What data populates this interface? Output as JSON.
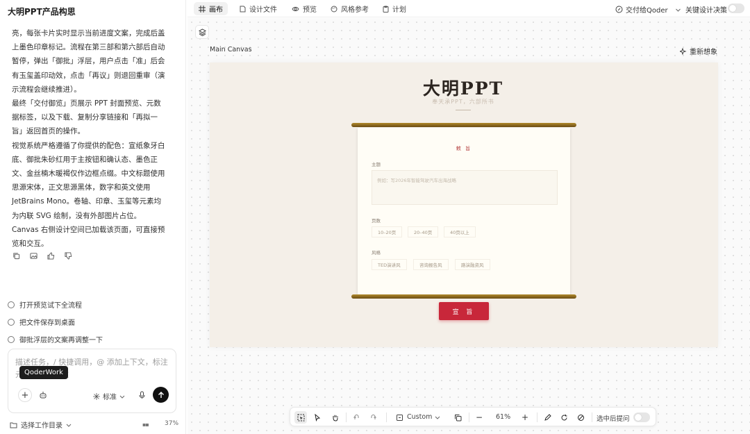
{
  "left_panel": {
    "title": "大明PPT产品构思",
    "chat_paragraphs": [
      "亮，每张卡片实时显示当前进度文案，完成后盖上墨色印章标记。流程在第三部和第六部后自动暂停，弹出「御批」浮层，用户点击「准」后会有玉玺盖印动效，点击「再议」则退回重审（演示流程会继续推进）。",
      "最终「交付御览」页展示 PPT 封面预览、元数据标签，以及下载、复制分享链接和「再拟一旨」返回首页的操作。",
      "视觉系统严格遵循了你提供的配色：宣纸象牙白底、御批朱砂红用于主按钮和确认态、墨色正文、金丝楠木暖褐仅作边框点缀。中文标题使用思源宋体，正文思源黑体，数字和英文使用 JetBrains Mono。卷轴、印章、玉玺等元素均为内联 SVG 绘制，没有外部图片占位。",
      "Canvas 右侧设计空间已加载该页面，可直接预览和交互。"
    ],
    "suggestions": [
      "打开预览试下全流程",
      "把文件保存到桌面",
      "御批浮层的文案再调整一下"
    ],
    "input_placeholder": "描述任务，/ 快捷调用，@ 添加上下文，标注元素以精准修改",
    "tooltip": "QoderWork",
    "mode_label": "标准",
    "workspace_label": "选择工作目录",
    "context_percent": "37%"
  },
  "top_tabs": [
    {
      "label": "画布",
      "active": true
    },
    {
      "label": "设计文件",
      "active": false
    },
    {
      "label": "预览",
      "active": false
    },
    {
      "label": "风格参考",
      "active": false
    },
    {
      "label": "计划",
      "active": false
    }
  ],
  "top_right": {
    "handoff_label": "交付给Qoder",
    "decision_label": "关键设计决策"
  },
  "canvas": {
    "label": "Main Canvas",
    "reimagine_label": "重新想象",
    "ppt_title": "大明PPT",
    "ppt_subtitle": "奉天承PPT，六部所书",
    "paper_heading": "敕 旨",
    "topic_label": "主题",
    "topic_placeholder": "例如：写2026年智能驾驶汽车出海战略",
    "pages_label": "页数",
    "pages_options": [
      "10–20页",
      "20–40页",
      "40页以上"
    ],
    "style_label": "风格",
    "style_options": [
      "TED演讲风",
      "咨询报告风",
      "路演融资风"
    ],
    "decree_button": "宣 旨"
  },
  "toolbar": {
    "preset_label": "Custom",
    "zoom": "61%",
    "ask_label": "选中后提问"
  },
  "colors": {
    "decree_red": "#c8273a",
    "paper": "#fffdf6",
    "rod_gold": "#9a7425",
    "frame_bg": "#f4efe8"
  }
}
